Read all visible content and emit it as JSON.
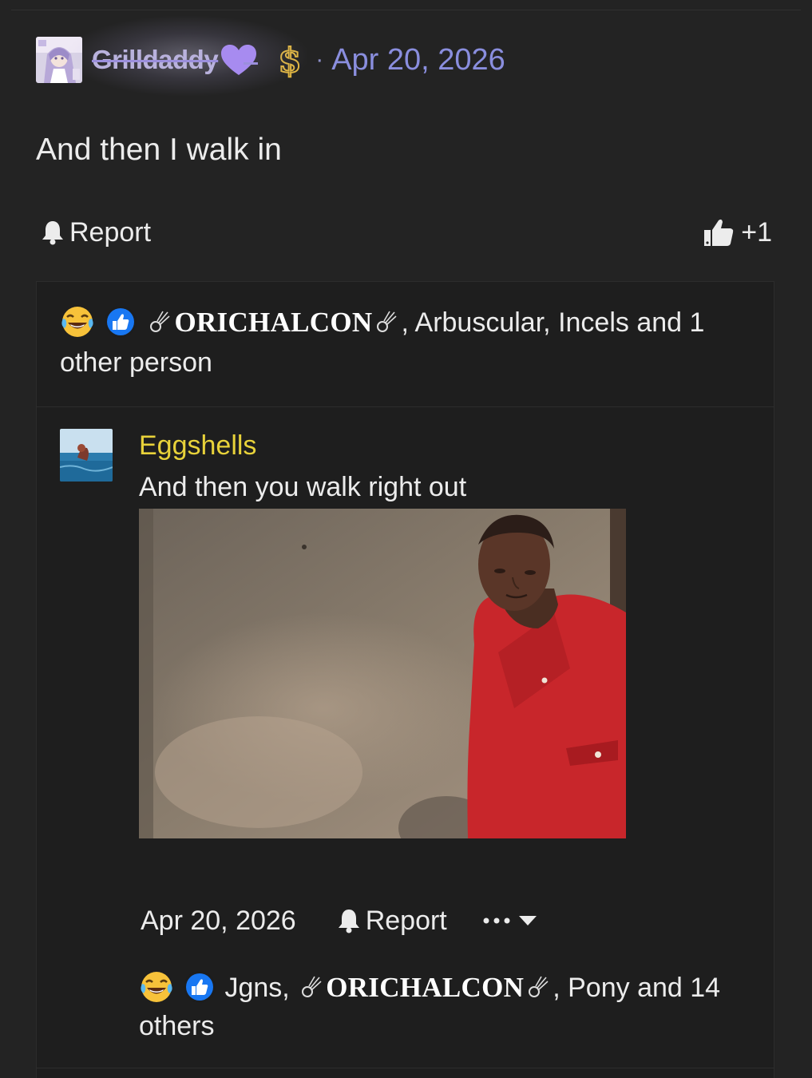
{
  "post": {
    "author": "Grilldaddy",
    "date_separator": "·",
    "date": "Apr 20, 2026",
    "body": "And then I walk in",
    "report_label": "Report",
    "like_count": "+1"
  },
  "post_reactions": {
    "emojis": [
      "laughing-crying-emoji",
      "like-badge"
    ],
    "names": [
      "ORICHALCON",
      "Arbuscular",
      "Incels"
    ],
    "separator_1": ",",
    "separator_2": ",",
    "and_text": "and 1 other person"
  },
  "reply": {
    "author": "Eggshells",
    "text": "And then you walk right out",
    "date": "Apr 20, 2026",
    "report_label": "Report",
    "more_label": "more-options",
    "reactions": {
      "names": [
        "Jgns",
        "ORICHALCON",
        "Pony"
      ],
      "sep": ",",
      "and_text": "and 14 others"
    }
  },
  "colors": {
    "background": "#232323",
    "panel": "#1e1e1e",
    "username": "#b9b2dd",
    "date": "#8a8ede",
    "reply_author": "#e8d23a",
    "like_blue": "#1877f2"
  }
}
